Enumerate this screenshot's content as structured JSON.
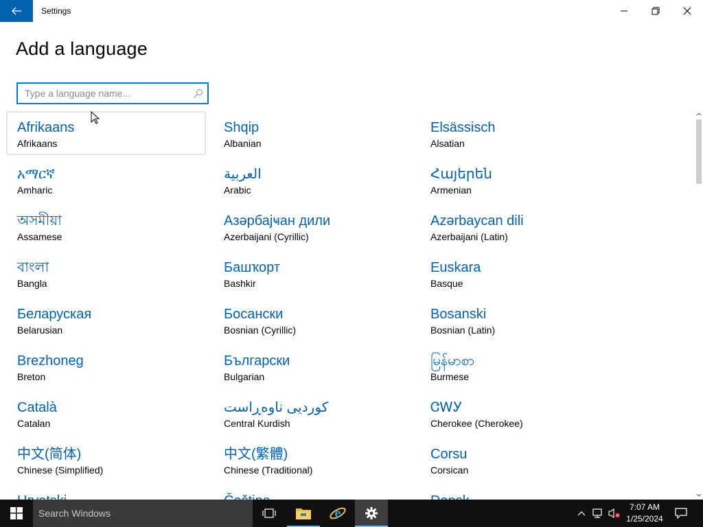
{
  "window": {
    "title": "Settings",
    "back_icon": "back-arrow-icon",
    "minimize_icon": "minimize-icon",
    "maximize_icon": "restore-icon",
    "close_icon": "close-icon",
    "accent": "#0063b1"
  },
  "page": {
    "title": "Add a language"
  },
  "search": {
    "placeholder": "Type a language name...",
    "value": "",
    "icon": "search-icon"
  },
  "languages": [
    {
      "native": "Afrikaans",
      "english": "Afrikaans"
    },
    {
      "native": "Shqip",
      "english": "Albanian"
    },
    {
      "native": "Elsässisch",
      "english": "Alsatian"
    },
    {
      "native": "አማርኛ",
      "english": "Amharic"
    },
    {
      "native": "العربية",
      "english": "Arabic"
    },
    {
      "native": "Հայերեն",
      "english": "Armenian"
    },
    {
      "native": "অসমীয়া",
      "english": "Assamese"
    },
    {
      "native": "Азәрбајҹан дили",
      "english": "Azerbaijani (Cyrillic)"
    },
    {
      "native": "Azərbaycan dili",
      "english": "Azerbaijani (Latin)"
    },
    {
      "native": "বাংলা",
      "english": "Bangla"
    },
    {
      "native": "Башҡорт",
      "english": "Bashkir"
    },
    {
      "native": "Euskara",
      "english": "Basque"
    },
    {
      "native": "Беларуская",
      "english": "Belarusian"
    },
    {
      "native": "Босански",
      "english": "Bosnian (Cyrillic)"
    },
    {
      "native": "Bosanski",
      "english": "Bosnian (Latin)"
    },
    {
      "native": "Brezhoneg",
      "english": "Breton"
    },
    {
      "native": "Български",
      "english": "Bulgarian"
    },
    {
      "native": "မြန်မာစာ",
      "english": "Burmese"
    },
    {
      "native": "Català",
      "english": "Catalan"
    },
    {
      "native": "کوردیی ناوەڕاست",
      "english": "Central Kurdish"
    },
    {
      "native": "ᏣᎳᎩ",
      "english": "Cherokee (Cherokee)"
    },
    {
      "native": "中文(简体)",
      "english": "Chinese (Simplified)"
    },
    {
      "native": "中文(繁體)",
      "english": "Chinese (Traditional)"
    },
    {
      "native": "Corsu",
      "english": "Corsican"
    },
    {
      "native": "Hrvatski",
      "english": ""
    },
    {
      "native": "Čeština",
      "english": ""
    },
    {
      "native": "Dansk",
      "english": ""
    }
  ],
  "scrollbar": {
    "up_icon": "scroll-up-arrow-icon",
    "down_icon": "scroll-down-arrow-icon"
  },
  "taskbar": {
    "start_icon": "windows-logo-icon",
    "search_placeholder": "Search Windows",
    "taskview_icon": "task-view-icon",
    "explorer_icon": "file-explorer-icon",
    "ie_icon": "internet-explorer-icon",
    "settings_icon": "settings-gear-icon",
    "tray": {
      "chevron_icon": "show-hidden-icons-chevron-icon",
      "network_icon": "network-icon",
      "volume_icon": "volume-muted-icon",
      "time": "7:07 AM",
      "date": "1/25/2024",
      "notification_icon": "action-center-icon"
    }
  }
}
